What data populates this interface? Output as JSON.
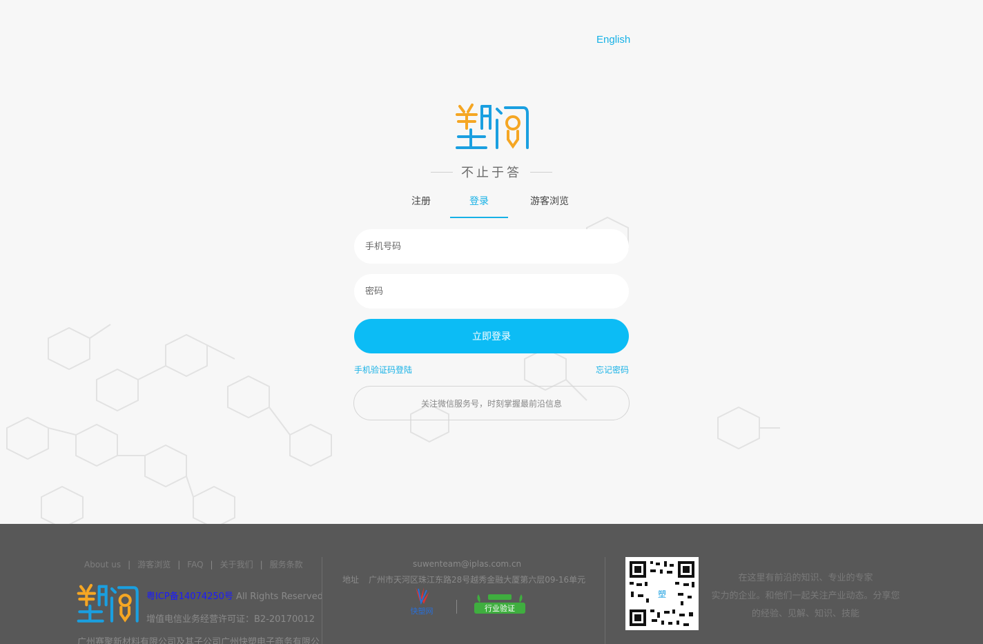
{
  "header": {
    "language_link": "English"
  },
  "brand": {
    "slogan": "不止于答"
  },
  "tabs": [
    {
      "label": "注册"
    },
    {
      "label": "登录"
    },
    {
      "label": "游客浏览"
    }
  ],
  "form": {
    "phone_placeholder": "手机号码",
    "password_placeholder": "密码",
    "login_button": "立即登录",
    "sms_login_link": "手机验证码登陆",
    "forgot_password_link": "忘记密码",
    "wechat_notice": "关注微信服务号，时刻掌握最前沿信息"
  },
  "footer": {
    "nav": [
      {
        "label": "About us"
      },
      {
        "label": "游客浏览"
      },
      {
        "label": "FAQ"
      },
      {
        "label": "关于我们"
      },
      {
        "label": "服务条款"
      }
    ],
    "icp_link": "粤ICP备14074250号",
    "rights": " All Rights Reserved",
    "license": "增值电信业务经营许可证：B2-20170012",
    "company": "广州赛聚新材料有限公司及其子公司广州快塑电子商务有限公司",
    "email": "suwenteam@iplas.com.cn",
    "address_label": "地址",
    "address": "广州市天河区珠江东路28号越秀金融大厦第六层09-16单元",
    "badge1_text": "快塑网",
    "badge2_text": "行业验证",
    "slogan_lines": [
      "在这里有前沿的知识、专业的专家",
      "实力的企业。和他们一起关注产业动态。分享您",
      "的经验、见解、知识、技能"
    ]
  },
  "colors": {
    "accent": "#16b1e6",
    "button": "#0cbcf5",
    "logo_orange": "#f5a623",
    "logo_blue": "#1a9fe0",
    "footer_bg": "#585858"
  }
}
